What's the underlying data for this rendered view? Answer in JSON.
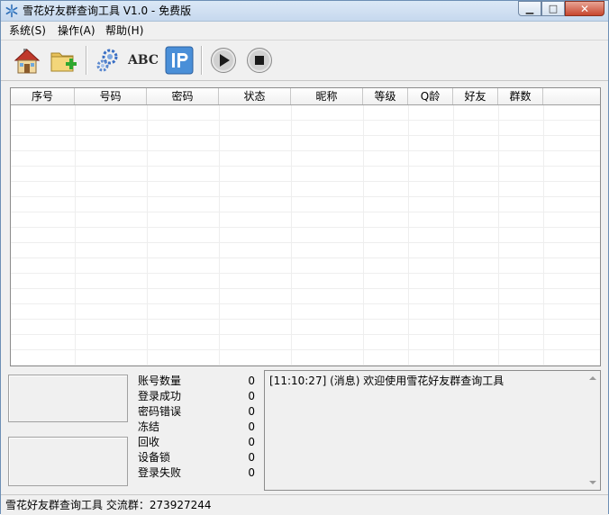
{
  "window": {
    "title": "雪花好友群查询工具 V1.0 - 免费版",
    "min_glyph": "▁",
    "max_glyph": "□",
    "close_glyph": "✕"
  },
  "menu": {
    "items": [
      {
        "label": "系统(S)"
      },
      {
        "label": "操作(A)"
      },
      {
        "label": "帮助(H)"
      }
    ]
  },
  "toolbar": {
    "buttons": [
      {
        "icon": "home-icon"
      },
      {
        "icon": "folder-add-icon"
      },
      {
        "icon": "settings-gears-icon"
      },
      {
        "icon": "abc-text-icon",
        "label": "ABC"
      },
      {
        "icon": "ip-icon",
        "label": "IP"
      },
      {
        "icon": "play-icon"
      },
      {
        "icon": "stop-icon"
      }
    ]
  },
  "table": {
    "columns": [
      "序号",
      "号码",
      "密码",
      "状态",
      "昵称",
      "等级",
      "Q龄",
      "好友",
      "群数"
    ],
    "rows": []
  },
  "stats": [
    {
      "label": "账号数量",
      "value": "0"
    },
    {
      "label": "登录成功",
      "value": "0"
    },
    {
      "label": "密码错误",
      "value": "0"
    },
    {
      "label": "冻结",
      "value": "0"
    },
    {
      "label": "回收",
      "value": "0"
    },
    {
      "label": "设备锁",
      "value": "0"
    },
    {
      "label": "登录失败",
      "value": "0"
    }
  ],
  "log": {
    "lines": [
      "[11:10:27] (消息) 欢迎使用雪花好友群查询工具"
    ]
  },
  "status": {
    "text": "雪花好友群查询工具 交流群：273927244"
  },
  "colors": {
    "ip_icon_bg": "#4a8fd8",
    "home_roof": "#c0392b",
    "folder": "#e8c25a",
    "plus_green": "#2fa82f",
    "gear": "#3a6fc4"
  }
}
